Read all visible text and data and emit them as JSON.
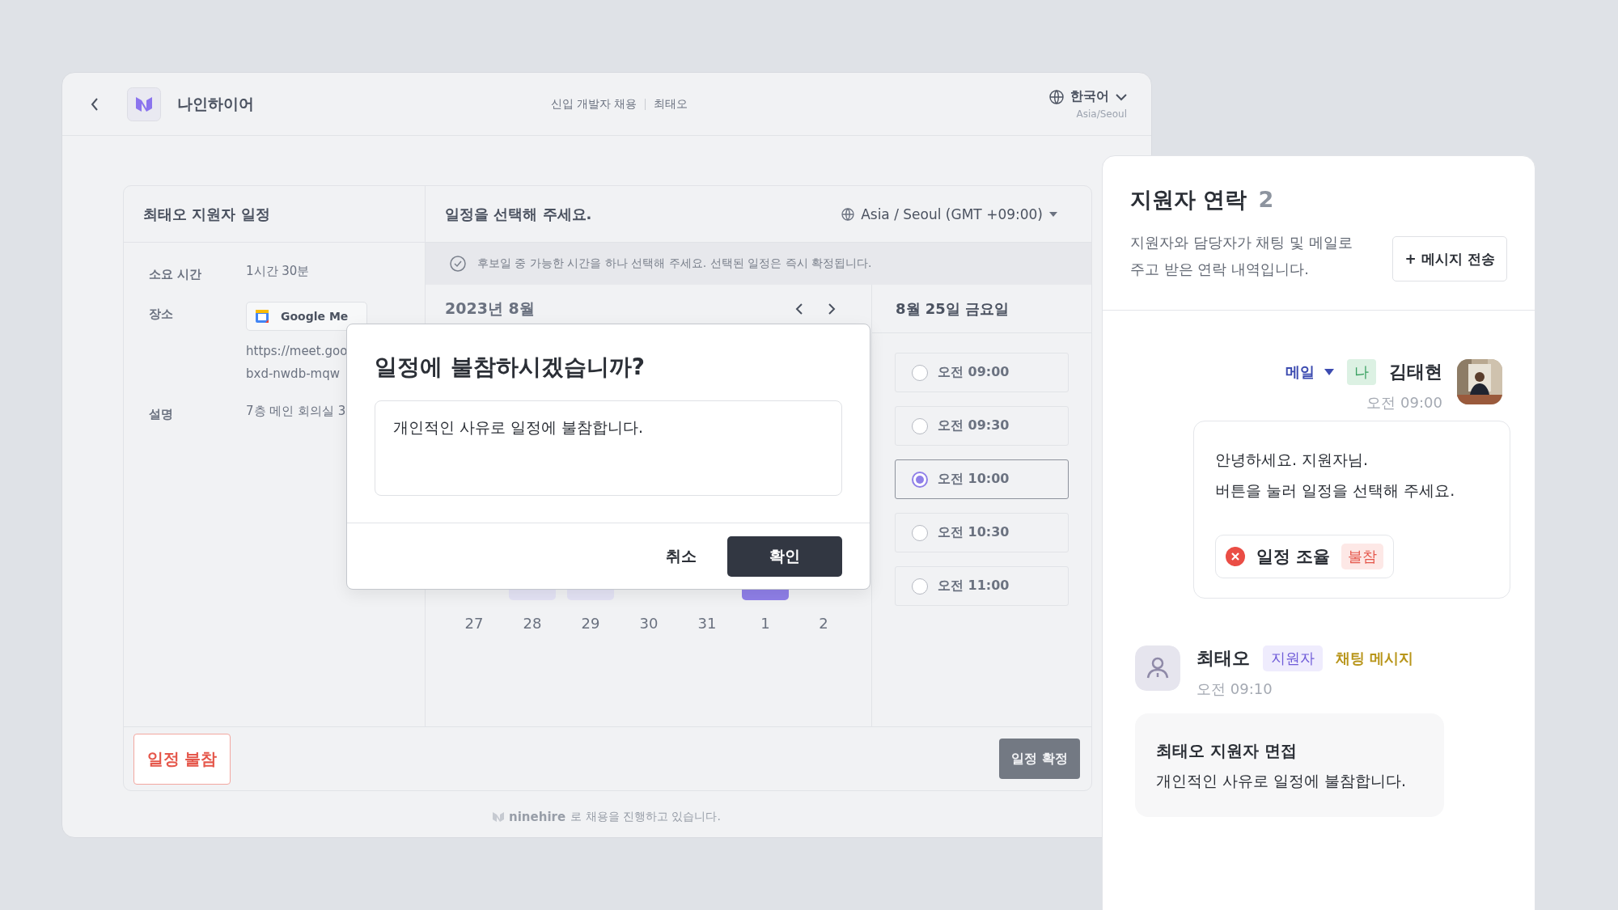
{
  "header": {
    "brand": "나인하이어",
    "breadcrumb": [
      "신입 개발자 채용",
      "최태오"
    ],
    "language": "한국어",
    "timezone": "Asia/Seoul"
  },
  "schedule": {
    "title": "최태오 지원자 일정",
    "details": [
      {
        "label": "소요 시간",
        "kind": "text",
        "lines": [
          "1시간 30분"
        ]
      },
      {
        "label": "장소",
        "kind": "meeting",
        "chip": "Google Me",
        "lines": [
          "https://meet.goo",
          "bxd-nwdb-mqw"
        ]
      },
      {
        "label": "설명",
        "kind": "text",
        "lines": [
          "7층 메인 회의실 3"
        ]
      }
    ],
    "prompt": "일정을 선택해 주세요.",
    "tz_select": "Asia / Seoul (GMT +09:00)",
    "notice": "후보일 중 가능한 시간을 하나 선택해 주세요. 선택된 일정은 즉시 확정됩니다.",
    "month": "2023년 8월",
    "week_marks": [
      {
        "kind": "none"
      },
      {
        "kind": "candidate"
      },
      {
        "kind": "candidate"
      },
      {
        "kind": "none"
      },
      {
        "kind": "none"
      },
      {
        "kind": "selected"
      },
      {
        "kind": "none"
      }
    ],
    "dates": [
      "27",
      "28",
      "29",
      "30",
      "31",
      "1",
      "2"
    ],
    "day_title": "8월 25일 금요일",
    "times": [
      {
        "label": "오전 09:00",
        "selected": false
      },
      {
        "label": "오전 09:30",
        "selected": false
      },
      {
        "label": "오전 10:00",
        "selected": true
      },
      {
        "label": "오전 10:30",
        "selected": false
      },
      {
        "label": "오전 11:00",
        "selected": false
      }
    ],
    "decline_button": "일정 불참",
    "confirm_button": "일정 확정"
  },
  "footer": {
    "brand": "ninehire",
    "text": "로 채용을 진행하고 있습니다."
  },
  "dialog": {
    "title": "일정에 불참하시겠습니까?",
    "value": "개인적인 사유로 일정에 불참합니다.",
    "buttons": [
      "취소",
      "확인"
    ]
  },
  "contacts": {
    "title": "지원자 연락",
    "count": "2",
    "description": "지원자와 담당자가 채팅 및 메일로 주고 받은 연락 내역입니다.",
    "send_button": "+ 메시지 전송",
    "messages": [
      {
        "kind": "outgoing",
        "channel": "메일",
        "me_badge": "나",
        "sender": "김태현",
        "time": "오전 09:00",
        "lines": [
          "안녕하세요. 지원자님.",
          "버튼을 눌러 일정을 선택해 주세요."
        ],
        "action": {
          "label": "일정 조율",
          "status": "불참"
        }
      },
      {
        "kind": "incoming",
        "sender": "최태오",
        "role": "지원자",
        "channel": "채팅 메시지",
        "time": "오전 09:10",
        "subject": "최태오 지원자 면접",
        "lines": [
          "개인적인 사유로 일정에 불참합니다."
        ]
      }
    ]
  }
}
